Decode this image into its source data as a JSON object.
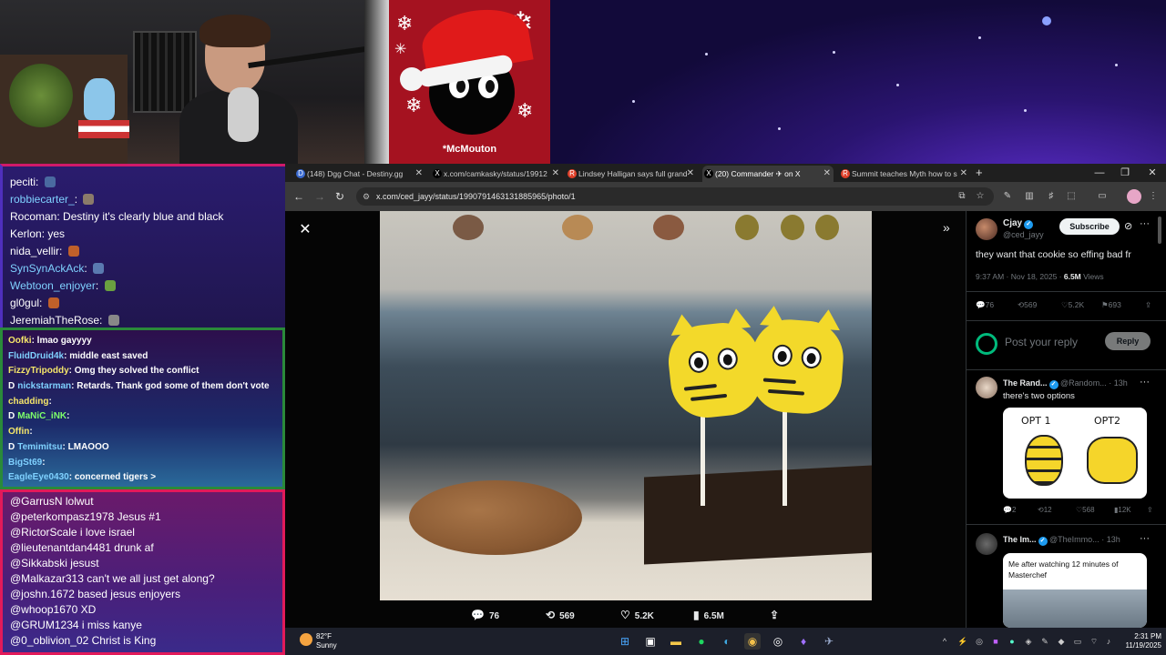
{
  "xmas_card": {
    "caption": "*McMouton"
  },
  "chat_top": [
    {
      "user": "peciti",
      "text": "",
      "user_color": "#ffffff",
      "emote": "#4a6aa0"
    },
    {
      "user": "robbiecarter_",
      "text": "",
      "user_color": "#7fd1ff",
      "emote": "#8b7b6a"
    },
    {
      "user": "Rocoman",
      "text": "Destiny it's clearly blue and black",
      "user_color": "#ffffff",
      "emote": ""
    },
    {
      "user": "Kerlon",
      "text": "yes",
      "user_color": "#ffffff",
      "emote": ""
    },
    {
      "user": "nida_vellir",
      "text": "",
      "user_color": "#ffffff",
      "emote": "#c0602a"
    },
    {
      "user": "SynSynAckAck",
      "text": "",
      "user_color": "#7fd1ff",
      "emote": "#5a7ab0"
    },
    {
      "user": "Webtoon_enjoyer",
      "text": "",
      "user_color": "#7fd1ff",
      "emote": "#6aa040"
    },
    {
      "user": "gl0gul",
      "text": "",
      "user_color": "#ffffff",
      "emote": "#c0602a"
    },
    {
      "user": "JeremiahTheRose",
      "text": "",
      "user_color": "#ffffff",
      "emote": "#888888"
    }
  ],
  "chat_mid": [
    {
      "user": "Oofki",
      "text": "lmao gayyyy",
      "user_color": "#f5e66a",
      "badge": ""
    },
    {
      "user": "FluidDruid4k",
      "text": "middle east saved",
      "user_color": "#7fd1ff",
      "badge": ""
    },
    {
      "user": "FizzyTripoddy",
      "text": "Omg they solved the conflict",
      "user_color": "#f5e66a",
      "badge": ""
    },
    {
      "user": "nickstarman",
      "text": "Retards. Thank god some of them don't vote",
      "user_color": "#7fd1ff",
      "badge": "D"
    },
    {
      "user": "chadding",
      "text": "",
      "user_color": "#f5e66a",
      "badge": ""
    },
    {
      "user": "MaNiC_iNK",
      "text": "",
      "user_color": "#7dff6a",
      "badge": "D"
    },
    {
      "user": "Offin",
      "text": "",
      "user_color": "#f5e66a",
      "badge": ""
    },
    {
      "user": "Temimitsu",
      "text": "LMAOOO",
      "user_color": "#7fd1ff",
      "badge": "D"
    },
    {
      "user": "BigSt69",
      "text": "",
      "user_color": "#7fd1ff",
      "badge": ""
    },
    {
      "user": "EagleEye0430",
      "text": "concerned tigers >",
      "user_color": "#7fd1ff",
      "badge": ""
    }
  ],
  "chat_bottom": [
    {
      "user": "@GarrusN",
      "text": "lolwut"
    },
    {
      "user": "@peterkompasz1978",
      "text": "Jesus #1"
    },
    {
      "user": "@RictorScale",
      "text": "i love israel"
    },
    {
      "user": "@lieutenantdan4481",
      "text": "drunk af"
    },
    {
      "user": "@Sikkabski",
      "text": "jesust"
    },
    {
      "user": "@Malkazar313",
      "text": "can't we all just get along?"
    },
    {
      "user": "@joshn.1672",
      "text": "based jesus enjoyers"
    },
    {
      "user": "@whoop1670",
      "text": "XD"
    },
    {
      "user": "@GRUM1234",
      "text": "i miss kanye"
    },
    {
      "user": "@0_oblivion_02",
      "text": "Christ is King"
    }
  ],
  "browser": {
    "tabs": [
      {
        "label": "(148) Dgg Chat - Destiny.gg",
        "icon": "D",
        "icon_color": "#3a6ad0",
        "active": false
      },
      {
        "label": "x.com/camkasky/status/19912",
        "icon": "X",
        "icon_color": "#000000",
        "active": false
      },
      {
        "label": "Lindsey Halligan says full grand",
        "icon": "R",
        "icon_color": "#e0402a",
        "active": false
      },
      {
        "label": "(20) Commander ✈ on X",
        "icon": "X",
        "icon_color": "#000000",
        "active": true
      },
      {
        "label": "Summit teaches Myth how to s",
        "icon": "R",
        "icon_color": "#e0402a",
        "active": false
      }
    ],
    "url": "x.com/ced_jayy/status/1990791463131885965/photo/1"
  },
  "viewer": {
    "stats": {
      "replies": "76",
      "reposts": "569",
      "likes": "5.2K",
      "views": "6.5M"
    }
  },
  "post": {
    "name": "Cjay",
    "handle": "@ced_jayy",
    "subscribe_label": "Subscribe",
    "text": "they want that cookie so effing bad fr",
    "time": "9:37 AM · Nov 18, 2025 · ",
    "views_count": "6.5M",
    "views_label": " Views",
    "stats": {
      "replies": "76",
      "reposts": "569",
      "likes": "5.2K",
      "bookmarks": "693"
    },
    "reply_placeholder": "Post your reply",
    "reply_button": "Reply"
  },
  "replies": [
    {
      "name": "The Rand...",
      "handle": "@Random...",
      "time": "· 13h",
      "text": "there's two options",
      "image_labels": [
        "OPT 1",
        "OPT2"
      ],
      "stats": {
        "replies": "2",
        "reposts": "12",
        "likes": "568",
        "views": "12K"
      }
    },
    {
      "name": "The Im...",
      "handle": "@TheImmo...",
      "time": "· 13h",
      "text": "",
      "image_caption": "Me after watching 12 minutes of Masterchef"
    }
  ],
  "taskbar": {
    "temperature": "82°F",
    "condition": "Sunny",
    "time": "2:31 PM",
    "date": "11/19/2025"
  }
}
